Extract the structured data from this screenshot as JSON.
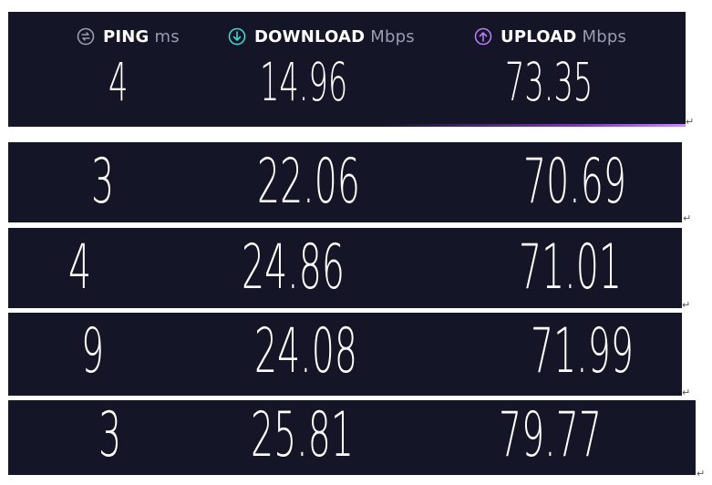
{
  "header": {
    "ping": {
      "name": "PING",
      "unit": "ms",
      "icon": "ping-icon",
      "color": "#9a9cb1"
    },
    "download": {
      "name": "DOWNLOAD",
      "unit": "Mbps",
      "icon": "download-arrow-icon",
      "color": "#3dd6d0"
    },
    "upload": {
      "name": "UPLOAD",
      "unit": "Mbps",
      "icon": "upload-arrow-icon",
      "color": "#b57cf7"
    }
  },
  "results": [
    {
      "ping": "4",
      "download": "14.96",
      "upload": "73.35"
    },
    {
      "ping": "3",
      "download": "22.06",
      "upload": "70.69"
    },
    {
      "ping": "4",
      "download": "24.86",
      "upload": "71.01"
    },
    {
      "ping": "9",
      "download": "24.08",
      "upload": "71.99"
    },
    {
      "ping": "3",
      "download": "25.81",
      "upload": "79.77"
    }
  ],
  "colors": {
    "panel_bg": "#141526",
    "text": "#ffffff",
    "unit_text": "#9a9cb1"
  },
  "paragraph_mark": "↵"
}
